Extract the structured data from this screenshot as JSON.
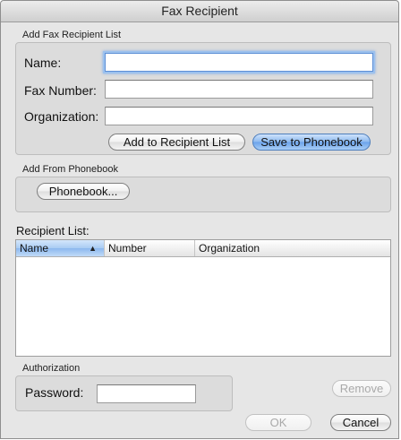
{
  "window": {
    "title": "Fax Recipient"
  },
  "add_group": {
    "label": "Add Fax Recipient List",
    "name_label": "Name:",
    "name_value": "",
    "fax_label": "Fax Number:",
    "fax_value": "",
    "org_label": "Organization:",
    "org_value": "",
    "add_button": "Add to Recipient List",
    "save_button": "Save to Phonebook"
  },
  "phonebook_group": {
    "label": "Add From Phonebook",
    "button": "Phonebook..."
  },
  "recipients": {
    "label": "Recipient List:",
    "columns": [
      "Name",
      "Number",
      "Organization"
    ],
    "sort_arrow": "▲",
    "rows": []
  },
  "auth": {
    "label": "Authorization",
    "password_label": "Password:",
    "password_value": ""
  },
  "buttons": {
    "remove": "Remove",
    "ok": "OK",
    "cancel": "Cancel"
  }
}
